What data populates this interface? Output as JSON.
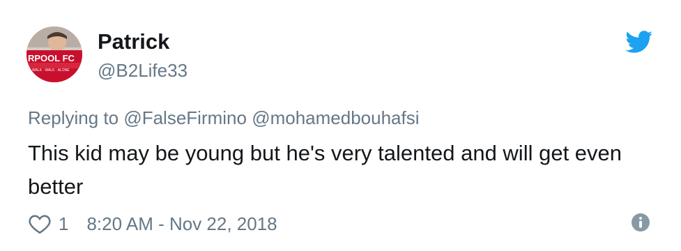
{
  "user": {
    "display_name": "Patrick",
    "handle": "@B2Life33",
    "avatar_text": "RPOOL FC"
  },
  "reply": {
    "prefix": "Replying to",
    "mentions": [
      "@FalseFirmino",
      "@mohamedbouhafsi"
    ]
  },
  "tweet": {
    "text": "This kid may be young but he's very talented and will get even better"
  },
  "footer": {
    "like_count": "1",
    "timestamp": "8:20 AM - Nov 22, 2018"
  },
  "icons": {
    "brand": "twitter-bird-icon",
    "like": "heart-icon",
    "info": "info-icon"
  },
  "colors": {
    "twitter_blue": "#1da1f2",
    "secondary_text": "#657786",
    "primary_text": "#14171a"
  }
}
